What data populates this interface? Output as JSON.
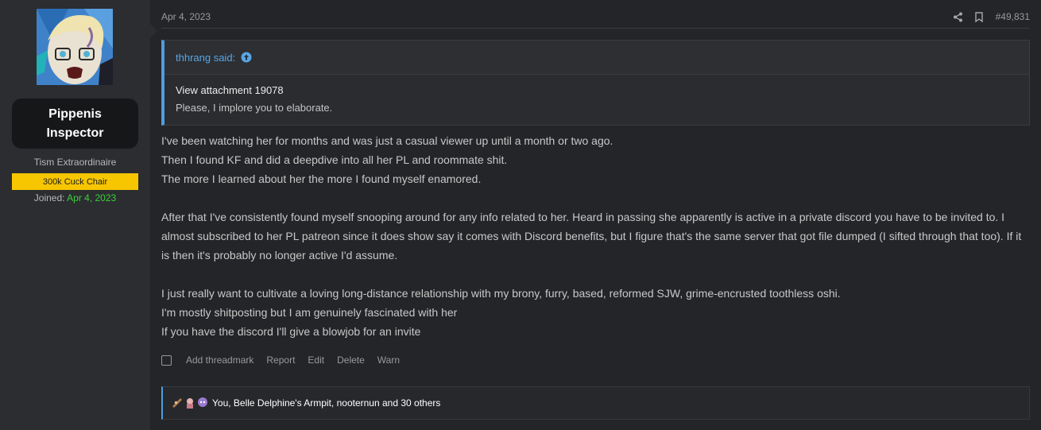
{
  "user": {
    "name": "Pippenis Inspector",
    "title": "Tism Extraordinaire",
    "banner": "300k Cuck Chair",
    "joined_label": "Joined:",
    "joined_date": "Apr 4, 2023"
  },
  "post": {
    "date": "Apr 4, 2023",
    "number": "#49,831",
    "quote": {
      "attribution": "thhrang said:",
      "attachment": "View attachment 19078",
      "text": "Please, I implore you to elaborate."
    },
    "message": [
      "I've been watching her for months and was just a casual viewer up until a month or two ago.",
      "Then I found KF and did a deepdive into all her PL and roommate shit.",
      "The more I learned about her the more I found myself enamored.",
      "",
      "After that I've consistently found myself snooping around for any info related to her. Heard in passing she apparently is active in a private discord you have to be invited to. I almost subscribed to her PL patreon since it does show say it comes with Discord benefits, but I figure that's the same server that got file dumped (I sifted through that too). If it is then it's probably no longer active I'd assume.",
      "",
      "I just really want to cultivate a loving long-distance relationship with my brony, furry, based, reformed SJW, grime-encrusted toothless oshi.",
      "I'm mostly shitposting but I am genuinely fascinated with her",
      "If you have the discord I'll give a blowjob for an invite"
    ],
    "actions": [
      "Add threadmark",
      "Report",
      "Edit",
      "Delete",
      "Warn"
    ],
    "reactions_text": "You, Belle Delphine's Armpit, nooternun and 30 others"
  },
  "colors": {
    "accent": "#4f9de0",
    "banner": "#f7c600",
    "joined_date": "#3cd03a"
  },
  "icons": [
    "share-icon",
    "bookmark-icon",
    "arrow-up-circle-icon"
  ]
}
